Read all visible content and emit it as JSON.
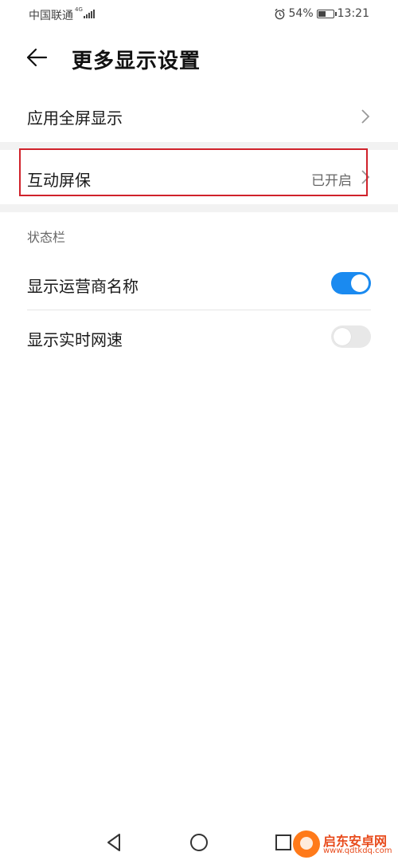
{
  "status_bar": {
    "carrier": "中国联通",
    "network": "4G",
    "battery": "54%",
    "battery_level": 0.54,
    "time": "13:21",
    "icons": [
      "signal-icon",
      "alarm-icon",
      "battery-charging-icon"
    ]
  },
  "header": {
    "back_icon": "back-arrow-icon",
    "title": "更多显示设置"
  },
  "settings": {
    "fullscreen": {
      "label": "应用全屏显示"
    },
    "screensaver": {
      "label": "互动屏保",
      "value": "已开启"
    }
  },
  "status_section": {
    "title": "状态栏",
    "items": [
      {
        "label": "显示运营商名称",
        "enabled": true
      },
      {
        "label": "显示实时网速",
        "enabled": false
      }
    ]
  },
  "nav_bar": {
    "icons": [
      "nav-back-icon",
      "nav-home-icon",
      "nav-recents-icon"
    ]
  },
  "watermark": {
    "text": "启东安卓网",
    "url": "www.qdtkdq.com"
  },
  "colors": {
    "toggle_on": "#1a8af0",
    "highlight_border": "#d0222b",
    "watermark": "#e84b1c"
  }
}
